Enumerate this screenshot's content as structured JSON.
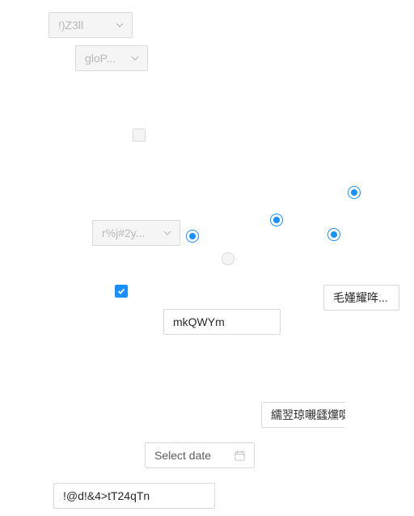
{
  "selects": [
    {
      "value": "!)Z3ll"
    },
    {
      "value": "gloP..."
    },
    {
      "value": "r%j#2y..."
    }
  ],
  "checkboxes": [
    {
      "checked": false,
      "disabled": true
    },
    {
      "checked": true,
      "disabled": false
    }
  ],
  "radios": [
    {
      "checked": true
    },
    {
      "checked": true
    },
    {
      "checked": true
    },
    {
      "checked": true
    },
    {
      "checked": false,
      "disabled": true
    }
  ],
  "buttons": {
    "button_1": "毛嫤耀哖...",
    "button_2": "繻翌琼嚫瓥爣哫"
  },
  "inputs": {
    "input_1": "mkQWYm",
    "input_2": "!@d!&4>tT24qTn"
  },
  "date_picker": {
    "placeholder": "Select date",
    "icon": "calendar-icon"
  },
  "colors": {
    "primary": "#1890ff",
    "border": "#d9d9d9",
    "disabled_bg": "#f5f5f5"
  }
}
